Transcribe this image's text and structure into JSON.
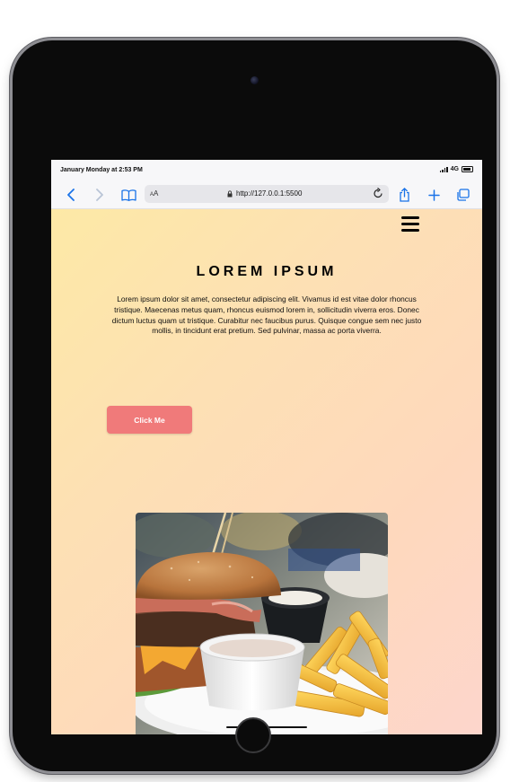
{
  "status_bar": {
    "time": "January Monday at 2:53 PM",
    "network": "4G"
  },
  "browser": {
    "reader_label": "AA",
    "url": "http://127.0.0.1:5500",
    "icons": [
      "chevron-left-icon",
      "chevron-right-icon",
      "bookmarks-icon",
      "lock-icon",
      "reload-icon",
      "share-icon",
      "plus-icon",
      "tabs-icon"
    ]
  },
  "page": {
    "heading": "LOREM IPSUM",
    "paragraph": "Lorem ipsum dolor sit amet, consectetur adipiscing elit. Vivamus id est vitae dolor rhoncus tristique. Maecenas metus quam, rhoncus euismod lorem in, sollicitudin viverra eros. Donec dictum luctus quam ut tristique. Curabitur nec faucibus purus. Quisque congue sem nec justo mollis, in tincidunt erat pretium. Sed pulvinar, massa ac porta viverra.",
    "button_label": "Click Me",
    "image_subject": "burger and fries"
  },
  "colors": {
    "button": "#f07a7a",
    "gradient_start": "#fde9a6",
    "gradient_end": "#fdd6cc",
    "link_blue": "#1a73e8"
  }
}
